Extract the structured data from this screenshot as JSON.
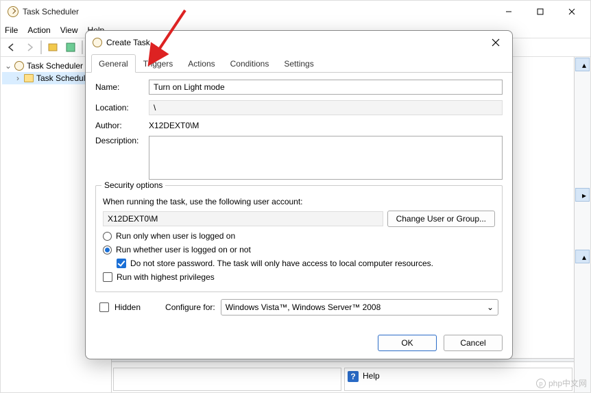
{
  "window": {
    "title": "Task Scheduler",
    "menus": [
      "File",
      "Action",
      "View",
      "Help"
    ]
  },
  "tree": {
    "root": "Task Scheduler (L",
    "child": "Task Schedule"
  },
  "bottompanel": {
    "help": "Help"
  },
  "dialog": {
    "title": "Create Task",
    "tabs": [
      "General",
      "Triggers",
      "Actions",
      "Conditions",
      "Settings"
    ],
    "active_tab": 0,
    "fields": {
      "name_label": "Name:",
      "name_value": "Turn on Light mode",
      "location_label": "Location:",
      "location_value": "\\",
      "author_label": "Author:",
      "author_value": "X12DEXT0\\M",
      "description_label": "Description:",
      "description_value": ""
    },
    "security": {
      "legend": "Security options",
      "when_running": "When running the task, use the following user account:",
      "account": "X12DEXT0\\M",
      "change_user": "Change User or Group...",
      "run_logged_on": "Run only when user is logged on",
      "run_whether": "Run whether user is logged on or not",
      "do_not_store": "Do not store password.  The task will only have access to local computer resources.",
      "highest_priv": "Run with highest privileges"
    },
    "hidden_label": "Hidden",
    "configure_for_label": "Configure for:",
    "configure_for_value": "Windows Vista™, Windows Server™ 2008",
    "ok": "OK",
    "cancel": "Cancel"
  },
  "watermark": "php中文网"
}
